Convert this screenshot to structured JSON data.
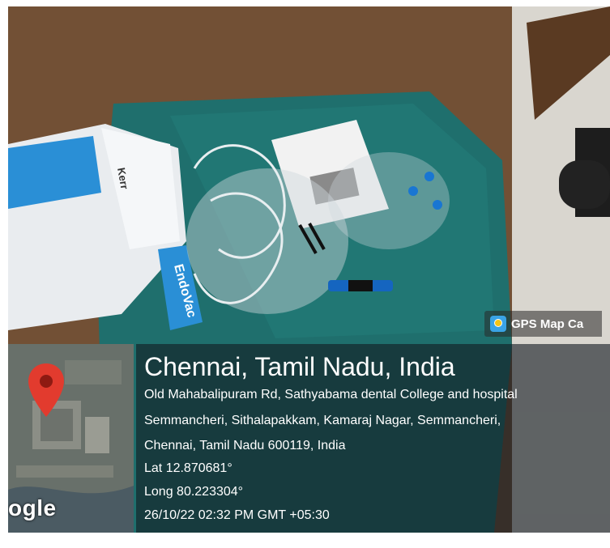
{
  "watermark": {
    "app_name": "GPS Map Ca",
    "app_icon": "gps-map-camera-icon"
  },
  "map": {
    "logo_text": "ogle",
    "pin_icon": "map-pin-icon",
    "pin_color": "#e23b2e"
  },
  "location": {
    "city": "Chennai, Tamil Nadu, India",
    "address_line1": "Old Mahabalipuram Rd, Sathyabama dental College and hospital",
    "address_line2": "Semmancheri, Sithalapakkam, Kamaraj Nagar, Semmancheri,",
    "address_line3": "Chennai, Tamil Nadu 600119, India",
    "latitude": "Lat 12.870681°",
    "longitude": "Long 80.223304°",
    "timestamp": "26/10/22 02:32 PM GMT +05:30"
  },
  "photo": {
    "package_brand": "Kerr",
    "package_label": "EndoVac",
    "tray_cloth_color": "#1f6f6d",
    "floor_color": "#6b4a33"
  }
}
